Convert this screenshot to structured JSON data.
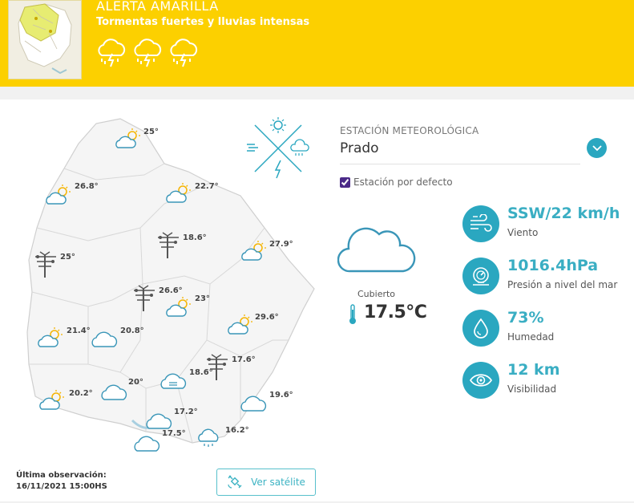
{
  "alert": {
    "title": "ALERTA AMARILLA",
    "subtitle": "Tormentas fuertes y lluvias intensas",
    "icons": [
      "thunderstorm-icon",
      "thunderstorm-icon",
      "thunderstorm-icon"
    ]
  },
  "map": {
    "stations": [
      {
        "temp": "25°",
        "icon": "partly-cloudy-icon"
      },
      {
        "temp": "26.8°",
        "icon": "partly-cloudy-icon"
      },
      {
        "temp": "22.7°",
        "icon": "partly-cloudy-icon"
      },
      {
        "temp": "25°",
        "icon": "wind-tower-icon"
      },
      {
        "temp": "18.6°",
        "icon": "wind-tower-icon"
      },
      {
        "temp": "27.9°",
        "icon": "partly-cloudy-icon"
      },
      {
        "temp": "26.6°",
        "icon": "wind-tower-icon"
      },
      {
        "temp": "23°",
        "icon": "partly-cloudy-icon"
      },
      {
        "temp": "21.4°",
        "icon": "partly-cloudy-icon"
      },
      {
        "temp": "20.8°",
        "icon": "cloud-icon"
      },
      {
        "temp": "29.6°",
        "icon": "partly-cloudy-icon"
      },
      {
        "temp": "17.6°",
        "icon": "wind-tower-icon"
      },
      {
        "temp": "18.6°",
        "icon": "fog-icon"
      },
      {
        "temp": "20°",
        "icon": "cloud-icon"
      },
      {
        "temp": "20.2°",
        "icon": "partly-cloudy-icon"
      },
      {
        "temp": "19.6°",
        "icon": "cloud-icon"
      },
      {
        "temp": "17.2°",
        "icon": "cloud-icon"
      },
      {
        "temp": "17.5°",
        "icon": "cloud-icon"
      },
      {
        "temp": "16.2°",
        "icon": "rain-cloud-icon"
      }
    ]
  },
  "footer": {
    "last_obs_label": "Última observación:",
    "last_obs_value": "16/11/2021 15:00HS",
    "satellite_button": "Ver satélite"
  },
  "station": {
    "caption": "ESTACIÓN METEOROLÓGICA",
    "name": "Prado",
    "default_label": "Estación por defecto",
    "default_checked": true
  },
  "current": {
    "condition": "Cubierto",
    "temperature": "17.5°C"
  },
  "metrics": [
    {
      "value": "SSW/22 km/h",
      "label": "Viento",
      "icon": "wind-icon"
    },
    {
      "value": "1016.4hPa",
      "label": "Presión a nivel del mar",
      "icon": "pressure-gauge-icon"
    },
    {
      "value": "73%",
      "label": "Humedad",
      "icon": "water-drop-icon"
    },
    {
      "value": "12 km",
      "label": "Visibilidad",
      "icon": "eye-icon"
    }
  ],
  "colors": {
    "alert_yellow": "#fcd000",
    "accent_teal": "#2aa7c0",
    "value_teal": "#3aaec3"
  }
}
